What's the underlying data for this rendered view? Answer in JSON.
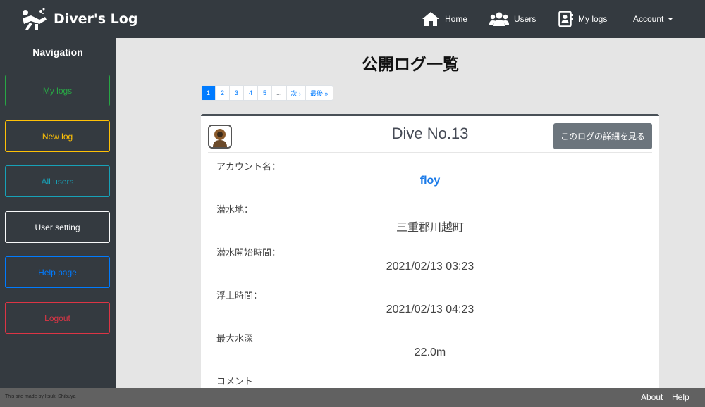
{
  "brand": {
    "name": "Diver's Log"
  },
  "nav": {
    "home": "Home",
    "users": "Users",
    "mylogs": "My logs",
    "account": "Account"
  },
  "sidebar": {
    "title": "Navigation",
    "items": [
      {
        "label": "My logs",
        "color": "#28a745"
      },
      {
        "label": "New log",
        "color": "#ffc107"
      },
      {
        "label": "All users",
        "color": "#17a2b8"
      },
      {
        "label": "User setting",
        "color": "#f8f9fa"
      },
      {
        "label": "Help page",
        "color": "#007bff"
      },
      {
        "label": "Logout",
        "color": "#dc3545"
      }
    ]
  },
  "main": {
    "title": "公開ログ一覧",
    "pagination": [
      "1",
      "2",
      "3",
      "4",
      "5",
      "...",
      "次 ›",
      "最後 »"
    ],
    "card": {
      "title": "Dive No.13",
      "detail_button": "このログの詳細を見る",
      "rows": [
        {
          "label": "アカウント名：",
          "value": "floy"
        },
        {
          "label": "潜水地：",
          "value": "三重郡川越町"
        },
        {
          "label": "潜水開始時間：",
          "value": "2021/02/13 03:23"
        },
        {
          "label": "浮上時間：",
          "value": "2021/02/13 04:23"
        },
        {
          "label": "最大水深",
          "value": "22.0m"
        },
        {
          "label": "コメント",
          "value": ""
        }
      ]
    }
  },
  "footer": {
    "credit": "This site made by Itsuki Shibuya",
    "about": "About",
    "help": "Help"
  }
}
